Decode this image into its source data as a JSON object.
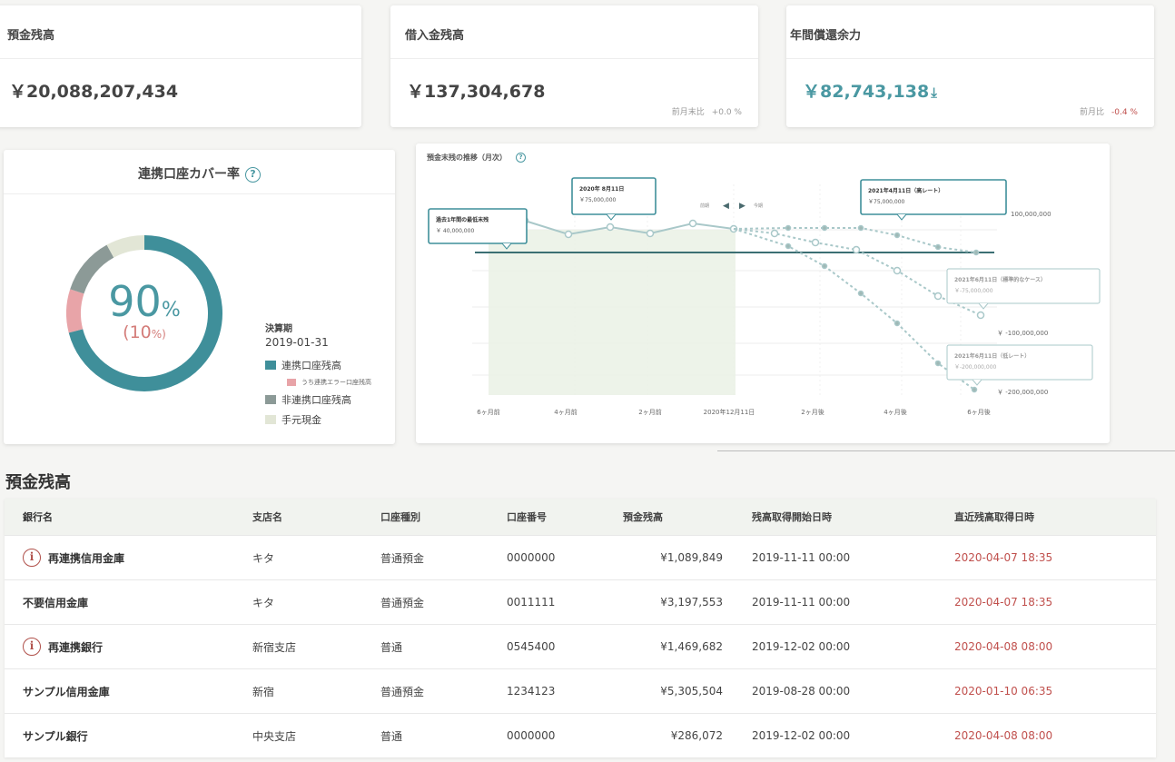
{
  "kpis": [
    {
      "title": "預金残高",
      "value": "￥20,088,207,434",
      "compare_label": "",
      "compare_value": ""
    },
    {
      "title": "借入金残高",
      "value": "￥137,304,678",
      "compare_label": "前月末比",
      "compare_value": "+0.0 %"
    },
    {
      "title": "年間償還余力",
      "value": "￥82,743,138",
      "compare_label": "前月比",
      "compare_value": "-0.4 %"
    }
  ],
  "coverage": {
    "title": "連携口座カバー率",
    "percent": "90",
    "percent_unit": "%",
    "sub_percent": "(10",
    "sub_percent_unit": "%)",
    "legend_title": "決算期",
    "legend_date": "2019-01-31",
    "legend": [
      {
        "label": "連携口座残高",
        "color": "#3f8f9a"
      },
      {
        "label": "うち連携エラー口座残高",
        "color": "#e8a4a8"
      },
      {
        "label": "非連携口座残高",
        "color": "#8c9a97"
      },
      {
        "label": "手元現金",
        "color": "#e2e6d6"
      }
    ],
    "donut_fractions": [
      0.71,
      0.09,
      0.12,
      0.08
    ]
  },
  "trend": {
    "title": "預金末残の推移（月次）",
    "tooltips": [
      {
        "title": "過去1年間の最低末残",
        "value": "￥ 40,000,000"
      },
      {
        "title": "2020年 8月11日",
        "value": "￥75,000,000"
      },
      {
        "title": "2021年4月11日（高レート）",
        "value": "￥75,000,000"
      },
      {
        "title": "2021年6月11日（標準的なケース）",
        "value": "￥-75,000,000"
      },
      {
        "title": "2021年6月11日（低レート）",
        "value": "￥-200,000,000"
      }
    ],
    "y_labels": [
      "100,000,000",
      "￥ -100,000,000",
      "￥ -200,000,000"
    ],
    "x_labels": [
      "6ヶ月前",
      "4ヶ月前",
      "2ヶ月前",
      "2020年12月11日",
      "2ヶ月後",
      "4ヶ月後",
      "6ヶ月後"
    ],
    "nav_left": "◀",
    "nav_right": "▶",
    "nav_left_text": "前期",
    "nav_right_text": "今期"
  },
  "table": {
    "title": "預金残高",
    "headers": [
      "銀行名",
      "支店名",
      "口座種別",
      "口座番号",
      "預金残高",
      "残高取得開始日時",
      "直近残高取得日時"
    ],
    "rows": [
      {
        "warn": true,
        "bank": "再連携信用金庫",
        "branch": "キタ",
        "type": "普通預金",
        "number": "0000000",
        "balance": "¥1,089,849",
        "start": "2019-11-11 00:00",
        "latest": "2020-04-07 18:35"
      },
      {
        "warn": false,
        "bank": "不要信用金庫",
        "branch": "キタ",
        "type": "普通預金",
        "number": "0011111",
        "balance": "¥3,197,553",
        "start": "2019-11-11 00:00",
        "latest": "2020-04-07 18:35"
      },
      {
        "warn": true,
        "bank": "再連携銀行",
        "branch": "新宿支店",
        "type": "普通",
        "number": "0545400",
        "balance": "¥1,469,682",
        "start": "2019-12-02 00:00",
        "latest": "2020-04-08 08:00"
      },
      {
        "warn": false,
        "bank": "サンプル信用金庫",
        "branch": "新宿",
        "type": "普通預金",
        "number": "1234123",
        "balance": "¥5,305,504",
        "start": "2019-08-28 00:00",
        "latest": "2020-01-10 06:35"
      },
      {
        "warn": false,
        "bank": "サンプル銀行",
        "branch": "中央支店",
        "type": "普通",
        "number": "0000000",
        "balance": "¥286,072",
        "start": "2019-12-02 00:00",
        "latest": "2020-04-08 08:00"
      }
    ]
  },
  "colors": {
    "teal": "#4a98a2",
    "negative": "#c0504d",
    "muted_red": "#d47d7a"
  }
}
